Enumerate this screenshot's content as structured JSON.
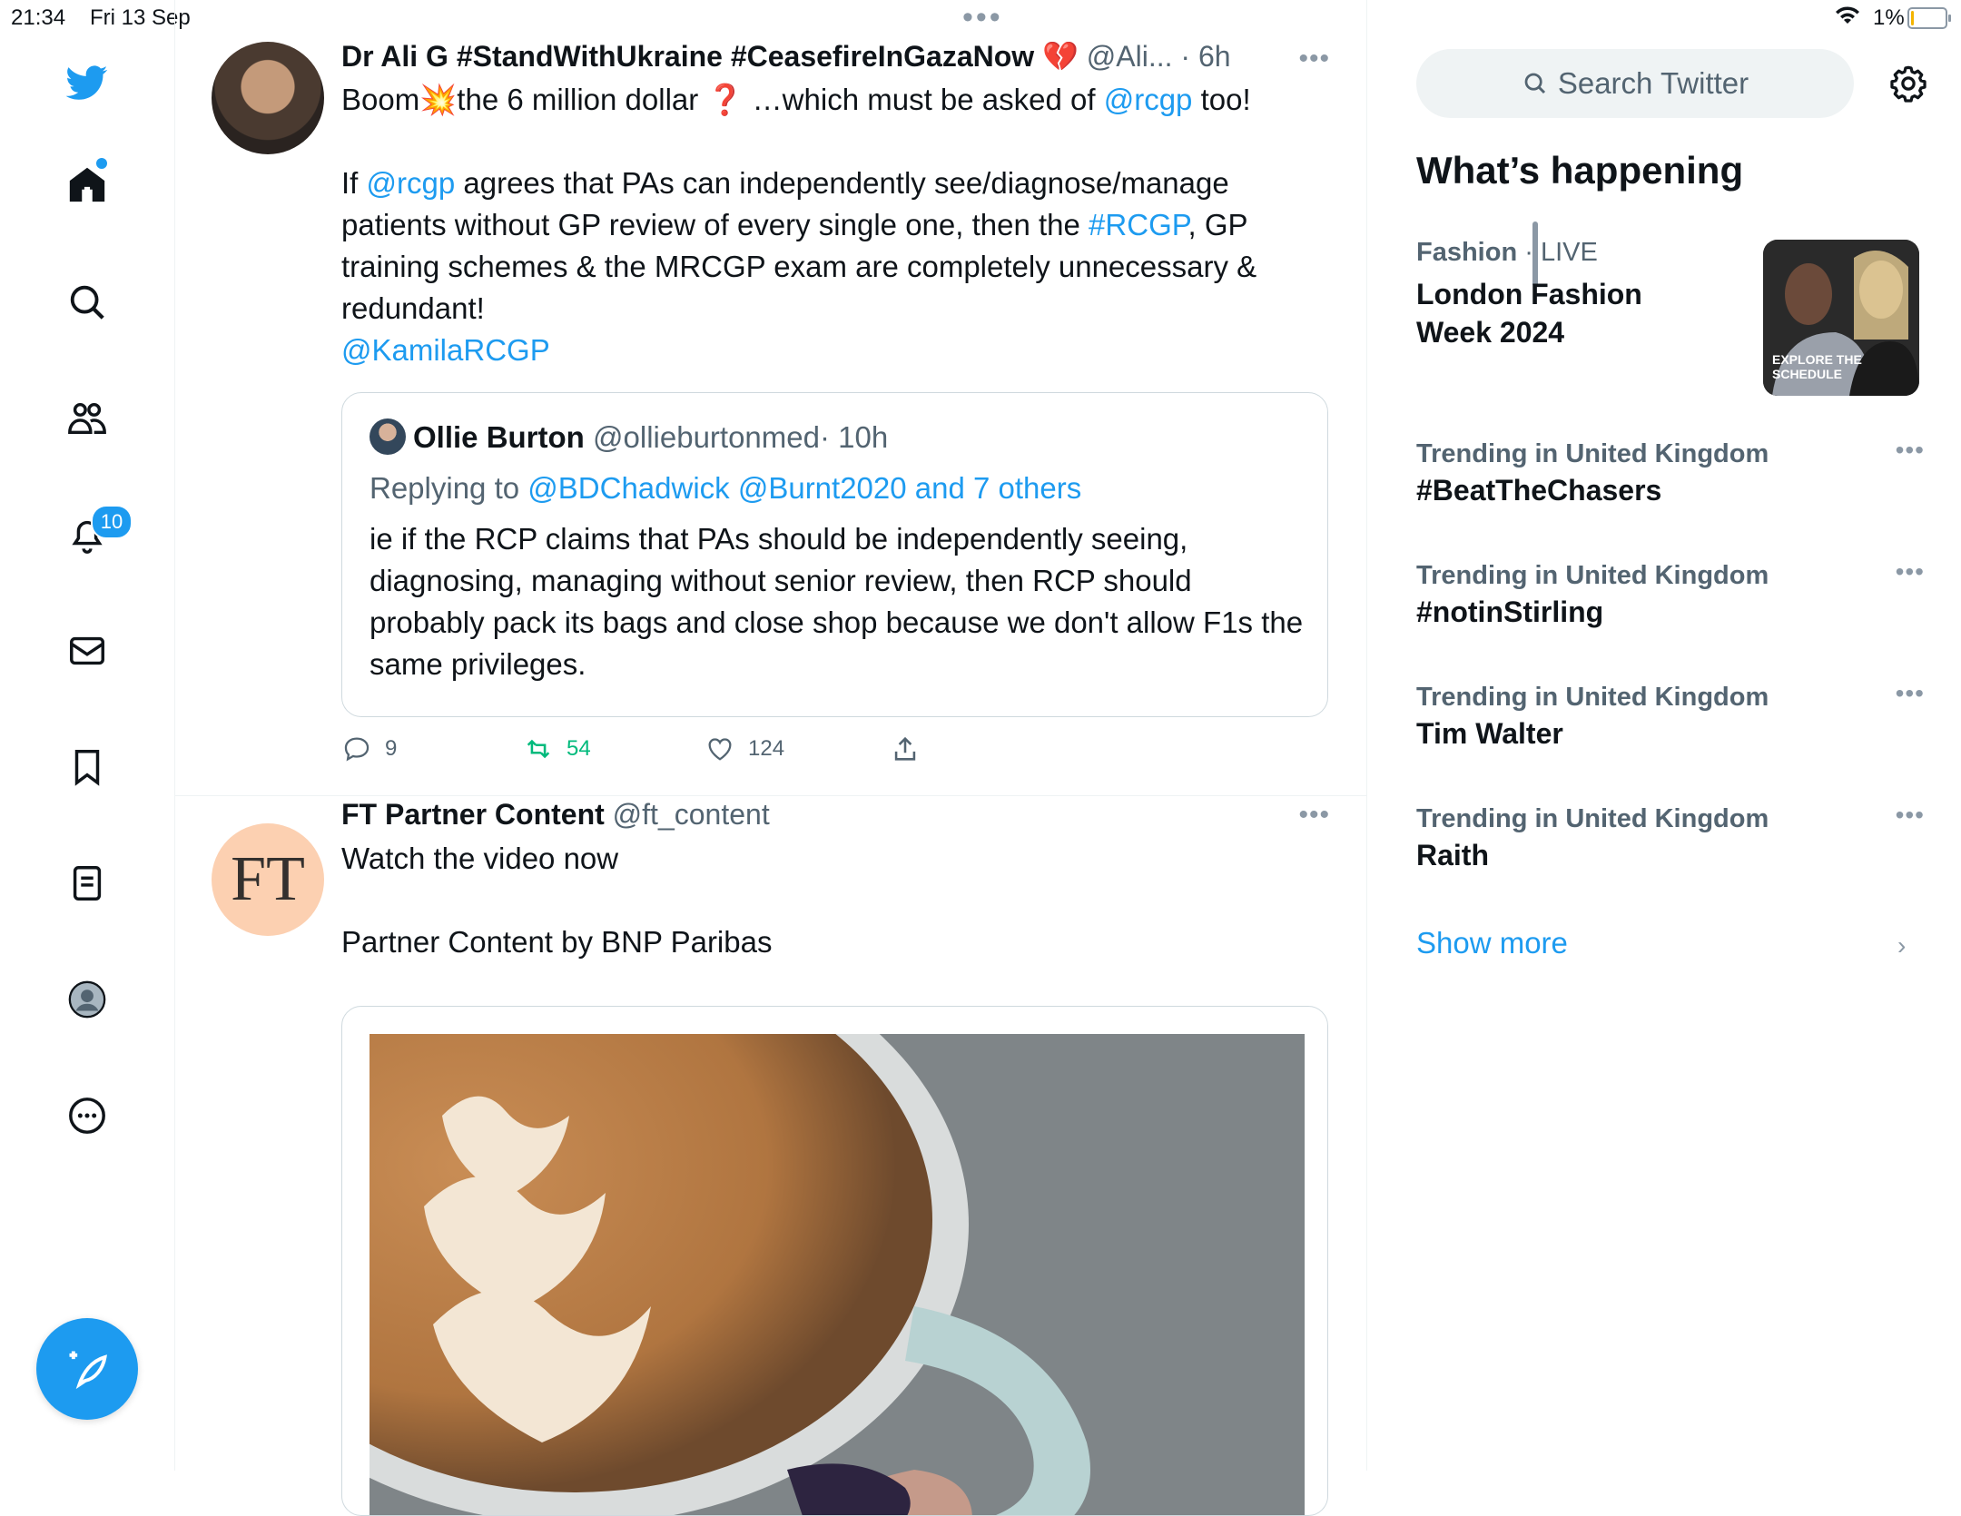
{
  "status": {
    "time": "21:34",
    "date": "Fri 13 Sep",
    "top_dots": "•••",
    "battery_pct": "1%",
    "battery_level": 0.01
  },
  "nav": {
    "notif_count": "10",
    "icons": [
      "twitter-logo-icon",
      "home-icon",
      "explore-icon",
      "communities-icon",
      "notifications-icon",
      "messages-icon",
      "bookmarks-icon",
      "lists-icon",
      "profile-icon",
      "more-icon"
    ]
  },
  "tweet1": {
    "name": "Dr Ali G #StandWithUkraine #CeasefireInGazaNow 💔",
    "handle": "@Ali...",
    "time": "· 6h",
    "more": "•••",
    "line1_a": "Boom💥the 6 million dollar ❓ …which must be asked of ",
    "line1_link": "@rcgp",
    "line1_b": " too!",
    "p2_a": "If ",
    "p2_link1": "@rcgp",
    "p2_b": " agrees that PAs can independently see/diagnose/manage patients without GP review of every single one, then the ",
    "p2_link2": "#RCGP",
    "p2_c": ", GP training schemes & the MRCGP exam are completely unnecessary & redundant!",
    "p3_link": "@KamilaRCGP",
    "quote": {
      "name": "Ollie Burton",
      "handle": "@ollieburtonmed",
      "time": "· 10h",
      "replying_prefix": "Replying to ",
      "replying_links": "@BDChadwick @Burnt2020 and 7 others",
      "text": "ie if the RCP claims that PAs should be independently seeing, diagnosing, managing without senior review, then RCP should probably pack its bags and close shop because we don't allow F1s the same privileges."
    },
    "replies": "9",
    "retweets": "54",
    "likes": "124"
  },
  "tweet2": {
    "avatar_text": "FT",
    "name": "FT Partner Content",
    "handle": "@ft_content",
    "more": "•••",
    "line1": "Watch the video now",
    "line2": "Partner Content by BNP Paribas"
  },
  "sidebar": {
    "search_placeholder": "Search Twitter",
    "heading": "What’s happening",
    "featured": {
      "category": "Fashion",
      "status": " · LIVE",
      "title": "London Fashion Week 2024",
      "image_caption": "EXPLORE THE SCHEDULE"
    },
    "trends": [
      {
        "meta": "Trending in United Kingdom",
        "title": "#BeatTheChasers"
      },
      {
        "meta": "Trending in United Kingdom",
        "title": "#notinStirling"
      },
      {
        "meta": "Trending in United Kingdom",
        "title": "Tim Walter"
      },
      {
        "meta": "Trending in United Kingdom",
        "title": "Raith"
      }
    ],
    "trend_more": "•••",
    "show_more": "Show more"
  }
}
